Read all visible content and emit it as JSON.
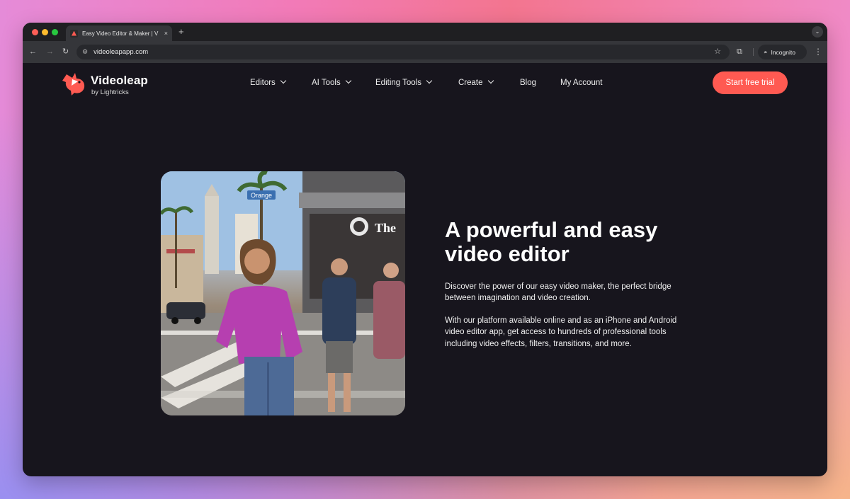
{
  "browser": {
    "tab_title": "Easy Video Editor & Maker | V",
    "tab_close": "×",
    "new_tab": "+",
    "url": "videoleapapp.com",
    "incognito_label": "Incognito"
  },
  "site": {
    "logo_name": "Videoleap",
    "logo_sub": "by Lightricks",
    "nav": [
      {
        "label": "Editors",
        "has_dropdown": true
      },
      {
        "label": "AI Tools",
        "has_dropdown": true
      },
      {
        "label": "Editing Tools",
        "has_dropdown": true
      },
      {
        "label": "Create",
        "has_dropdown": true
      },
      {
        "label": "Blog",
        "has_dropdown": false
      },
      {
        "label": "My Account",
        "has_dropdown": false
      }
    ],
    "cta_label": "Start free trial",
    "brand_color": "#ff5a52"
  },
  "hero": {
    "title": "A powerful and easy video editor",
    "paragraph1": "Discover the power of our easy video maker, the perfect bridge between imagination and video creation.",
    "paragraph2": "With our platform available online and as an iPhone and Android video editor app, get access to hundreds of professional tools including video effects, filters, transitions, and more.",
    "media_signs": [
      "Orange",
      "The"
    ]
  }
}
